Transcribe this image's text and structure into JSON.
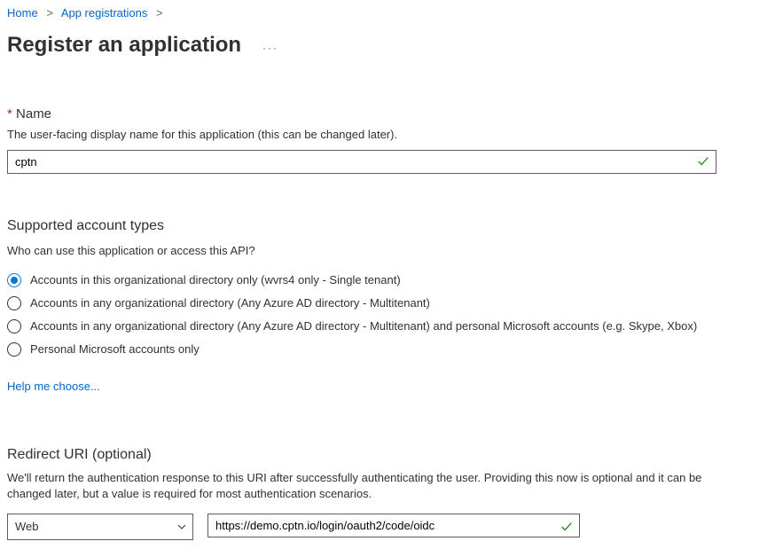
{
  "breadcrumb": {
    "home": "Home",
    "app_registrations": "App registrations"
  },
  "page_title": "Register an application",
  "name": {
    "label": "Name",
    "desc": "The user-facing display name for this application (this can be changed later).",
    "value": "cptn"
  },
  "supported": {
    "title": "Supported account types",
    "sub": "Who can use this application or access this API?",
    "options": {
      "o1": "Accounts in this organizational directory only (wvrs4 only - Single tenant)",
      "o2": "Accounts in any organizational directory (Any Azure AD directory - Multitenant)",
      "o3": "Accounts in any organizational directory (Any Azure AD directory - Multitenant) and personal Microsoft accounts (e.g. Skype, Xbox)",
      "o4": "Personal Microsoft accounts only"
    },
    "help_link": "Help me choose..."
  },
  "redirect": {
    "title": "Redirect URI (optional)",
    "desc": "We'll return the authentication response to this URI after successfully authenticating the user. Providing this now is optional and it can be changed later, but a value is required for most authentication scenarios.",
    "platform": "Web",
    "uri": "https://demo.cptn.io/login/oauth2/code/oidc"
  }
}
